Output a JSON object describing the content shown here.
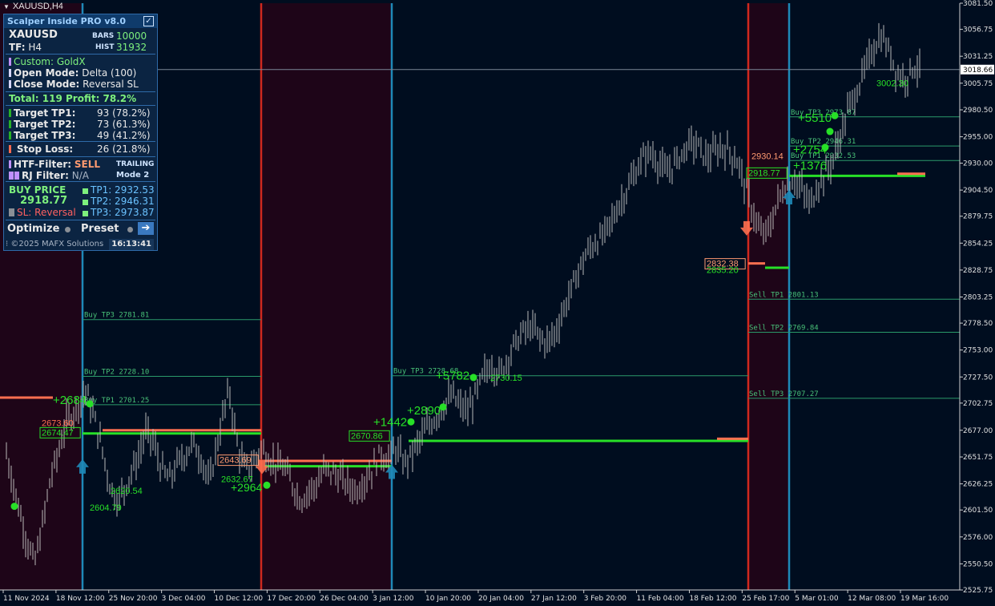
{
  "window": {
    "title": "XAUUSD,H4"
  },
  "panel": {
    "header": "Scalper Inside PRO v8.0",
    "symbol": "XAUUSD",
    "tf_label": "TF:",
    "tf_value": "H4",
    "bars_label": "BARS",
    "bars_value": "10000",
    "hist_label": "HIST",
    "hist_value": "31932",
    "custom": "Custom: GoldX",
    "open_mode_label": "Open Mode:",
    "open_mode_value": "Delta (100)",
    "close_mode_label": "Close Mode:",
    "close_mode_value": "Reversal SL",
    "total": "Total: 119  Profit: 78.2%",
    "tp1_label": "Target TP1:",
    "tp1_value": "93 (78.2%)",
    "tp2_label": "Target TP2:",
    "tp2_value": "73 (61.3%)",
    "tp3_label": "Target TP3:",
    "tp3_value": "49 (41.2%)",
    "sl_label": "Stop Loss:",
    "sl_value": "26 (21.8%)",
    "htf_label": "HTF-Filter:",
    "htf_value": "SELL",
    "rj_label": "RJ Filter:",
    "rj_value": "N/A",
    "trailing": "TRAILING",
    "mode": "Mode 2",
    "buy_price_label": "BUY PRICE",
    "buy_price_value": "2918.77",
    "sl_reversal": "SL: Reversal",
    "tp1_line": "TP1: 2932.53",
    "tp2_line": "TP2: 2946.31",
    "tp3_line": "TP3: 2973.87",
    "optimize": "Optimize",
    "preset": "Preset",
    "copyright": "©2025 MAFX Solutions",
    "clock": "16:13:41"
  },
  "colors": {
    "background": "#000d1f",
    "sell_zone": "#1e0518",
    "price_line": "#b9b9b9",
    "buy_marker": "#27e027",
    "sell_marker": "#ff7050",
    "blue_sep": "#1e89b8",
    "red_sep": "#d0281e"
  },
  "chart_data": {
    "type": "candlestick",
    "symbol": "XAUUSD",
    "timeframe": "H4",
    "y_ticks": [
      "3081.50",
      "3056.75",
      "3031.25",
      "3005.75",
      "2980.50",
      "2955.00",
      "2930.00",
      "2904.50",
      "2879.75",
      "2854.25",
      "2828.75",
      "2803.25",
      "2778.50",
      "2753.00",
      "2727.50",
      "2702.75",
      "2677.00",
      "2651.75",
      "2626.25",
      "2601.50",
      "2576.00",
      "2550.50",
      "2525.75"
    ],
    "ylim": [
      2525.75,
      3081.5
    ],
    "x_ticks": [
      "11 Nov 2024",
      "18 Nov 12:00",
      "25 Nov 20:00",
      "3 Dec 04:00",
      "10 Dec 12:00",
      "17 Dec 20:00",
      "26 Dec 04:00",
      "3 Jan 12:00",
      "10 Jan 20:00",
      "20 Jan 04:00",
      "27 Jan 12:00",
      "3 Feb 20:00",
      "11 Feb 04:00",
      "18 Feb 12:00",
      "25 Feb 17:00",
      "5 Mar 01:00",
      "12 Mar 08:00",
      "19 Mar 16:00"
    ],
    "current_price": "3018.66",
    "price_path": [
      [
        0,
        2655
      ],
      [
        0.03,
        2605
      ],
      [
        0.05,
        2575
      ],
      [
        0.07,
        2550
      ],
      [
        0.09,
        2585
      ],
      [
        0.11,
        2630
      ],
      [
        0.13,
        2655
      ],
      [
        0.15,
        2685
      ],
      [
        0.18,
        2700
      ],
      [
        0.2,
        2715
      ],
      [
        0.22,
        2690
      ],
      [
        0.24,
        2660
      ],
      [
        0.26,
        2625
      ],
      [
        0.28,
        2610
      ],
      [
        0.3,
        2625
      ],
      [
        0.33,
        2650
      ],
      [
        0.35,
        2675
      ],
      [
        0.37,
        2665
      ],
      [
        0.39,
        2640
      ],
      [
        0.41,
        2630
      ],
      [
        0.43,
        2645
      ],
      [
        0.45,
        2655
      ],
      [
        0.47,
        2665
      ],
      [
        0.49,
        2650
      ],
      [
        0.5,
        2640
      ],
      [
        0.51,
        2625
      ],
      [
        0.53,
        2665
      ],
      [
        0.55,
        2700
      ],
      [
        0.56,
        2715
      ],
      [
        0.57,
        2690
      ],
      [
        0.58,
        2665
      ],
      [
        0.59,
        2650
      ],
      [
        0.6,
        2640
      ],
      [
        0.62,
        2645
      ],
      [
        0.64,
        2660
      ],
      [
        0.66,
        2650
      ],
      [
        0.68,
        2645
      ],
      [
        0.7,
        2640
      ],
      [
        0.72,
        2625
      ],
      [
        0.74,
        2610
      ],
      [
        0.76,
        2620
      ],
      [
        0.78,
        2625
      ],
      [
        0.8,
        2640
      ],
      [
        0.83,
        2635
      ],
      [
        0.86,
        2625
      ],
      [
        0.88,
        2620
      ],
      [
        0.9,
        2630
      ],
      [
        0.92,
        2640
      ],
      [
        0.94,
        2655
      ],
      [
        0.96,
        2650
      ],
      [
        0.98,
        2660
      ],
      [
        1.0,
        2645
      ],
      [
        1.02,
        2655
      ],
      [
        1.05,
        2675
      ],
      [
        1.08,
        2690
      ],
      [
        1.1,
        2700
      ],
      [
        1.12,
        2710
      ],
      [
        1.14,
        2700
      ],
      [
        1.16,
        2695
      ],
      [
        1.18,
        2710
      ],
      [
        1.2,
        2730
      ],
      [
        1.22,
        2740
      ],
      [
        1.24,
        2730
      ],
      [
        1.26,
        2745
      ],
      [
        1.28,
        2760
      ],
      [
        1.3,
        2770
      ],
      [
        1.32,
        2775
      ],
      [
        1.34,
        2765
      ],
      [
        1.36,
        2760
      ],
      [
        1.38,
        2770
      ],
      [
        1.4,
        2790
      ],
      [
        1.42,
        2810
      ],
      [
        1.44,
        2830
      ],
      [
        1.46,
        2845
      ],
      [
        1.48,
        2855
      ],
      [
        1.5,
        2860
      ],
      [
        1.52,
        2875
      ],
      [
        1.54,
        2890
      ],
      [
        1.56,
        2905
      ],
      [
        1.58,
        2920
      ],
      [
        1.6,
        2935
      ],
      [
        1.62,
        2940
      ],
      [
        1.64,
        2930
      ],
      [
        1.66,
        2920
      ],
      [
        1.68,
        2930
      ],
      [
        1.7,
        2940
      ],
      [
        1.72,
        2950
      ],
      [
        1.74,
        2945
      ],
      [
        1.76,
        2935
      ],
      [
        1.78,
        2940
      ],
      [
        1.8,
        2945
      ],
      [
        1.82,
        2940
      ],
      [
        1.84,
        2930
      ],
      [
        1.86,
        2905
      ],
      [
        1.88,
        2880
      ],
      [
        1.9,
        2860
      ],
      [
        1.92,
        2870
      ],
      [
        1.94,
        2895
      ],
      [
        1.96,
        2910
      ],
      [
        1.98,
        2915
      ],
      [
        2.0,
        2905
      ],
      [
        2.02,
        2890
      ],
      [
        2.04,
        2910
      ],
      [
        2.06,
        2920
      ],
      [
        2.08,
        2935
      ],
      [
        2.1,
        2960
      ],
      [
        2.12,
        2985
      ],
      [
        2.14,
        3000
      ],
      [
        2.16,
        3020
      ],
      [
        2.18,
        3040
      ],
      [
        2.2,
        3050
      ],
      [
        2.22,
        3035
      ],
      [
        2.24,
        3015
      ],
      [
        2.26,
        3010
      ],
      [
        2.28,
        3022
      ],
      [
        2.3,
        3018
      ]
    ],
    "levels": [
      {
        "label": "Buy TP3 2781.81",
        "price": 2781.81
      },
      {
        "label": "Buy TP2 2728.10",
        "price": 2728.1
      },
      {
        "label": "Buy TP1 2701.25",
        "price": 2701.25
      },
      {
        "label": "Buy TP3 2728.68",
        "price": 2728.68
      },
      {
        "label": "Sell TP1 2801.13",
        "price": 2801.13
      },
      {
        "label": "Sell TP2 2769.84",
        "price": 2769.84
      },
      {
        "label": "Sell TP3 2707.27",
        "price": 2707.27
      },
      {
        "label": "Buy TP3 2973.87",
        "price": 2973.87
      },
      {
        "label": "Buy TP2 2946.31",
        "price": 2946.31
      },
      {
        "label": "Buy TP1 2932.53",
        "price": 2932.53
      }
    ],
    "annotations": [
      {
        "text": "+2684",
        "price": 2702
      },
      {
        "text": "2673.60",
        "price": 2681
      },
      {
        "text": "2674.47",
        "price": 2672
      },
      {
        "text": "2643.69",
        "price": 2646
      },
      {
        "text": "2632.67",
        "price": 2628
      },
      {
        "text": "+2964",
        "price": 2619
      },
      {
        "text": "2620.54",
        "price": 2617
      },
      {
        "text": "2604.79",
        "price": 2601
      },
      {
        "text": "2670.86",
        "price": 2669
      },
      {
        "text": "+1442",
        "price": 2681
      },
      {
        "text": "+2890",
        "price": 2692
      },
      {
        "text": "+5782",
        "price": 2725
      },
      {
        "text": "2730.15",
        "price": 2724
      },
      {
        "text": "2930.14",
        "price": 2934
      },
      {
        "text": "2918.77",
        "price": 2918
      },
      {
        "text": "2832.38",
        "price": 2832
      },
      {
        "text": "2835.20",
        "price": 2826
      },
      {
        "text": "+5510",
        "price": 2969
      },
      {
        "text": "+2754",
        "price": 2939
      },
      {
        "text": "+1376",
        "price": 2924
      },
      {
        "text": "3002.30",
        "price": 3003
      }
    ]
  }
}
